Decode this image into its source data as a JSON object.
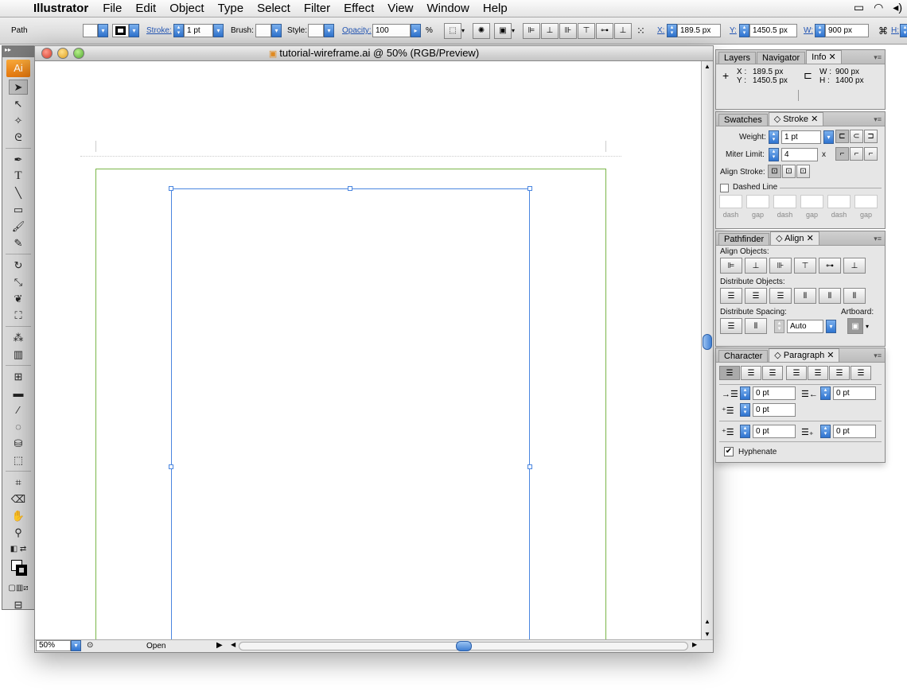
{
  "menubar": {
    "app": "Illustrator",
    "items": [
      "File",
      "Edit",
      "Object",
      "Type",
      "Select",
      "Filter",
      "Effect",
      "View",
      "Window",
      "Help"
    ]
  },
  "control": {
    "selection_type": "Path",
    "stroke_label": "Stroke:",
    "stroke_weight": "1 pt",
    "brush_label": "Brush:",
    "style_label": "Style:",
    "opacity_label": "Opacity:",
    "opacity_value": "100",
    "percent": "%",
    "x_label": "X:",
    "x_value": "189.5 px",
    "y_label": "Y:",
    "y_value": "1450.5 px",
    "w_label": "W:",
    "w_value": "900 px",
    "h_label": "H:"
  },
  "document": {
    "title": "tutorial-wireframe.ai @ 50% (RGB/Preview)",
    "zoom": "50%",
    "status": "Open"
  },
  "toolbox": {
    "app_badge": "Ai"
  },
  "info_panel": {
    "tabs": [
      "Layers",
      "Navigator",
      "Info"
    ],
    "x_label": "X :",
    "x_value": "189.5 px",
    "y_label": "Y :",
    "y_value": "1450.5 px",
    "w_label": "W :",
    "w_value": "900 px",
    "h_label": "H :",
    "h_value": "1400 px"
  },
  "stroke_panel": {
    "tabs": [
      "Swatches",
      "Stroke"
    ],
    "weight_label": "Weight:",
    "weight_value": "1 pt",
    "miter_label": "Miter Limit:",
    "miter_value": "4",
    "miter_suffix": "x",
    "align_label": "Align Stroke:",
    "dashed_label": "Dashed Line",
    "dash_labels": [
      "dash",
      "gap",
      "dash",
      "gap",
      "dash",
      "gap"
    ]
  },
  "align_panel": {
    "tabs": [
      "Pathfinder",
      "Align"
    ],
    "align_objects_label": "Align Objects:",
    "distribute_objects_label": "Distribute Objects:",
    "distribute_spacing_label": "Distribute Spacing:",
    "artboard_label": "Artboard:",
    "spacing_value": "Auto"
  },
  "paragraph_panel": {
    "tabs": [
      "Character",
      "Paragraph"
    ],
    "left_indent": "0 pt",
    "right_indent": "0 pt",
    "first_line_indent": "0 pt",
    "space_before": "0 pt",
    "space_after": "0 pt",
    "hyphenate_label": "Hyphenate"
  }
}
